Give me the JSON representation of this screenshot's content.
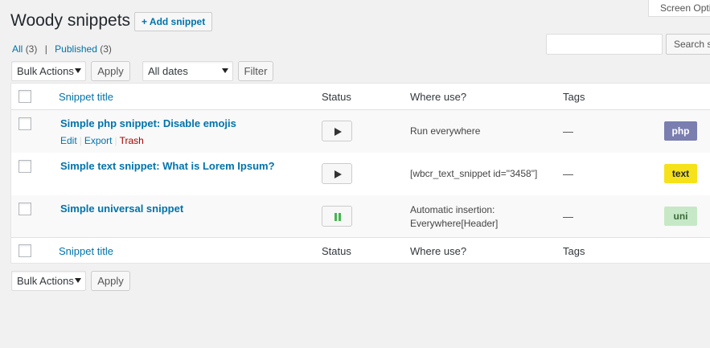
{
  "header": {
    "title": "Woody snippets",
    "add_label": "+ Add snippet",
    "screen_options": "Screen Options"
  },
  "filters_links": {
    "all": "All",
    "all_count": "(3)",
    "separator": "|",
    "published": "Published",
    "published_count": "(3)"
  },
  "search": {
    "value": "",
    "button": "Search snippets"
  },
  "top_bar": {
    "bulk_selected": "Bulk Actions",
    "apply": "Apply",
    "dates_selected": "All dates",
    "filter": "Filter"
  },
  "table": {
    "columns": {
      "title": "Snippet title",
      "status": "Status",
      "where": "Where use?",
      "tags": "Tags"
    },
    "row_actions": {
      "edit": "Edit",
      "export": "Export",
      "trash": "Trash"
    },
    "rows": [
      {
        "title": "Simple php snippet: Disable emojis",
        "status": "inactive",
        "where_line1": "Run everywhere",
        "where_line2": "",
        "tags": "—",
        "type": "php",
        "type_bg": "#7a7fb0",
        "type_fg": "#ffffff"
      },
      {
        "title": "Simple text snippet: What is Lorem Ipsum?",
        "status": "inactive",
        "where_line1": "[wbcr_text_snippet id=\"3458\"]",
        "where_line2": "",
        "tags": "—",
        "type": "text",
        "type_bg": "#f5e21a",
        "type_fg": "#23282d"
      },
      {
        "title": "Simple universal snippet",
        "status": "active",
        "where_line1": "Automatic insertion:",
        "where_line2": "Everywhere[Header]",
        "tags": "—",
        "type": "uni",
        "type_bg": "#c6e8c6",
        "type_fg": "#3a6b3a"
      }
    ]
  },
  "bottom_bar": {
    "bulk_selected": "Bulk Actions",
    "apply": "Apply"
  },
  "icons": {
    "play": "play-icon",
    "pause": "pause-icon",
    "active_color": "#46b450"
  }
}
